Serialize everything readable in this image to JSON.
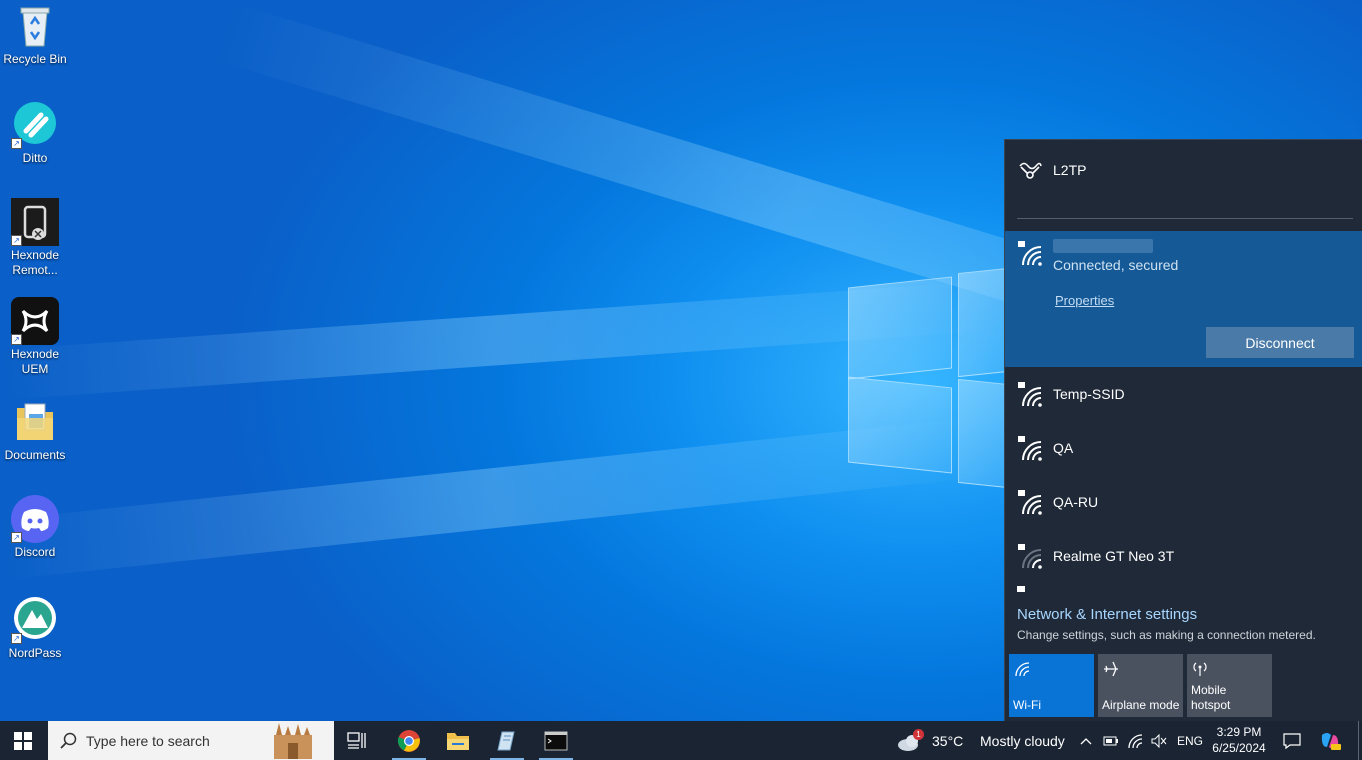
{
  "desktop": {
    "icons": [
      {
        "name": "recycle-bin",
        "label": "Recycle Bin"
      },
      {
        "name": "ditto",
        "label": "Ditto"
      },
      {
        "name": "hexnode-remote",
        "label": "Hexnode Remot..."
      },
      {
        "name": "hexnode-uem",
        "label_line1": "Hexnode",
        "label_line2": "UEM"
      },
      {
        "name": "documents",
        "label": "Documents"
      },
      {
        "name": "discord",
        "label": "Discord"
      },
      {
        "name": "nordpass",
        "label": "NordPass"
      }
    ]
  },
  "network_flyout": {
    "vpn": {
      "name": "L2TP"
    },
    "connected_network": {
      "status": "Connected, secured",
      "properties_label": "Properties",
      "disconnect_label": "Disconnect"
    },
    "networks": [
      {
        "name": "Temp-SSID"
      },
      {
        "name": "QA"
      },
      {
        "name": "QA-RU"
      },
      {
        "name": "Realme GT Neo 3T"
      }
    ],
    "settings_link": "Network & Internet settings",
    "settings_desc": "Change settings, such as making a connection metered.",
    "quick_actions": [
      {
        "label": "Wi-Fi",
        "active": true
      },
      {
        "label": "Airplane mode",
        "active": false
      },
      {
        "label_line1": "Mobile",
        "label_line2": "hotspot",
        "active": false
      }
    ]
  },
  "taskbar": {
    "search_placeholder": "Type here to search",
    "weather": {
      "temp": "35°C",
      "condition": "Mostly cloudy",
      "badge": "1"
    },
    "language": "ENG",
    "time": "3:29 PM",
    "date": "6/25/2024"
  },
  "colors": {
    "flyout_bg": "#1f2937",
    "connected_bg": "#155a96",
    "accent": "#0a74d6",
    "taskbar_bg": "#1a2433"
  }
}
